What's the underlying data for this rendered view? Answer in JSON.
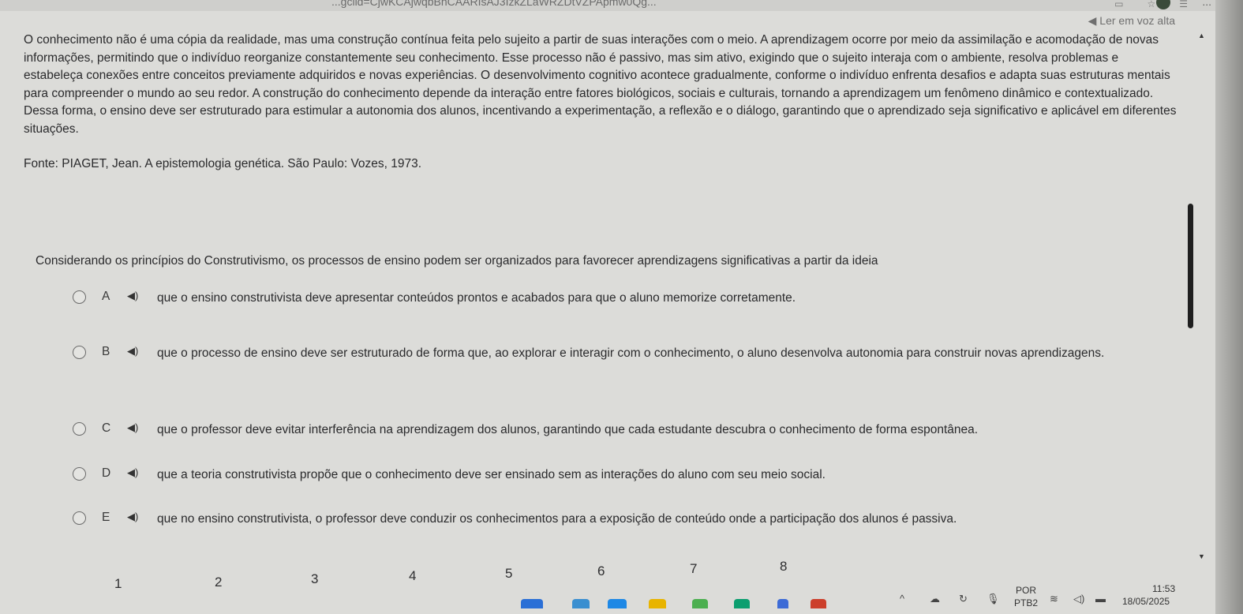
{
  "browser": {
    "url": "...gclid=CjwKCAjwqbBhCAARIsAJ3IzkZLaWRZDtVZPApmw0Qg...",
    "more": "..."
  },
  "tts_label": "Ler em voz alta",
  "passage": "O conhecimento não é uma cópia da realidade, mas uma construção contínua feita pelo sujeito a partir de suas interações com o meio. A aprendizagem ocorre por meio da assimilação e acomodação de novas informações, permitindo que o indivíduo reorganize constantemente seu conhecimento. Esse processo não é passivo, mas sim ativo, exigindo que o sujeito interaja com o ambiente, resolva problemas e estabeleça conexões entre conceitos previamente adquiridos e novas experiências. O desenvolvimento cognitivo acontece gradualmente, conforme o indivíduo enfrenta desafios e adapta suas estruturas mentais para compreender o mundo ao seu redor. A construção do conhecimento depende da interação entre fatores biológicos, sociais e culturais, tornando a aprendizagem um fenômeno dinâmico e contextualizado. Dessa forma, o ensino deve ser estruturado para estimular a autonomia dos alunos, incentivando a experimentação, a reflexão e o diálogo, garantindo que o aprendizado seja significativo e aplicável em diferentes situações.",
  "source": "Fonte: PIAGET, Jean. A epistemologia genética. São Paulo: Vozes, 1973.",
  "question": "Considerando os princípios do Construtivismo, os processos de ensino podem ser organizados para favorecer aprendizagens significativas a partir da ideia",
  "options": [
    {
      "letter": "A",
      "text": "que o ensino construtivista deve apresentar conteúdos prontos e acabados para que o aluno memorize corretamente."
    },
    {
      "letter": "B",
      "text": "que o processo de ensino deve ser estruturado de forma que, ao explorar e interagir com o conhecimento, o aluno desenvolva autonomia para construir novas aprendizagens."
    },
    {
      "letter": "C",
      "text": "que o professor deve evitar interferência na aprendizagem dos alunos, garantindo que cada estudante descubra o conhecimento de forma espontânea."
    },
    {
      "letter": "D",
      "text": "que a teoria construtivista propõe que o conhecimento deve ser ensinado sem as interações do aluno com seu meio social."
    },
    {
      "letter": "E",
      "text": "que no ensino construtivista, o professor deve conduzir os conhecimentos para a exposição de conteúdo onde a participação dos alunos é passiva."
    }
  ],
  "pages": [
    "1",
    "2",
    "3",
    "4",
    "5",
    "6",
    "7",
    "8"
  ],
  "taskbar": {
    "language_top": "POR",
    "language_bottom": "PTB2",
    "time": "11:53",
    "date": "18/05/2025",
    "colors": [
      "#2a6fd6",
      "#3a8fd0",
      "#1e88e5",
      "#e8b400",
      "#4caf50",
      "#0b9e6f",
      "#cc3f2b",
      "#3d6bd6"
    ]
  }
}
